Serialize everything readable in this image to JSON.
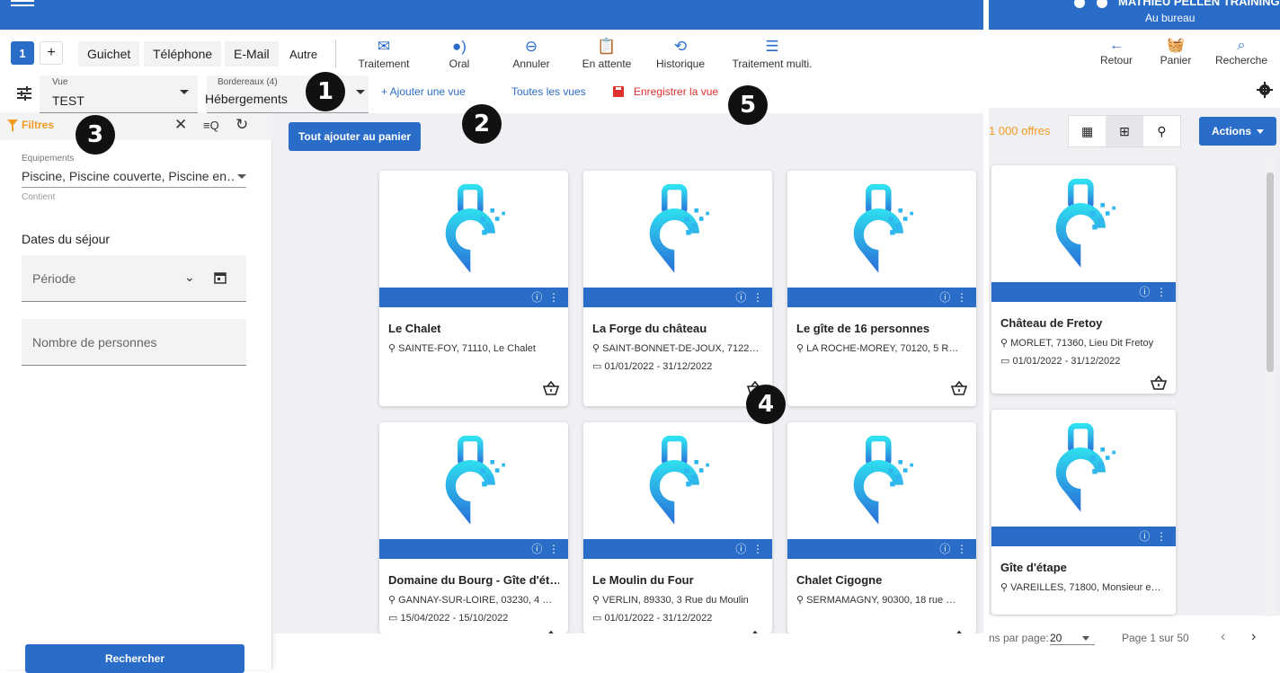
{
  "header": {
    "user_name": "MATHIEU PELLEN TRAINING",
    "user_status": "Au bureau"
  },
  "toolbar": {
    "tab_number": "1",
    "tab_add": "+",
    "channels": [
      "Guichet",
      "Téléphone",
      "E-Mail",
      "Autre"
    ],
    "tools": [
      {
        "label": "Traitement",
        "icon": "mail-icon"
      },
      {
        "label": "Oral",
        "icon": "voice-icon"
      },
      {
        "label": "Annuler",
        "icon": "cancel-icon"
      },
      {
        "label": "En attente",
        "icon": "clipboard-icon"
      },
      {
        "label": "Historique",
        "icon": "history-icon"
      },
      {
        "label": "Traitement multi.",
        "icon": "list-icon"
      }
    ]
  },
  "view_bar": {
    "vue_label": "Vue",
    "vue_value": "TEST",
    "bordereaux_label": "Bordereaux (4)",
    "bordereaux_value": "Hébergements",
    "add_view": "+ Ajouter une vue",
    "all_views": "Toutes les vues",
    "save_view": "Enregistrer la vue"
  },
  "filters": {
    "title": "Filtres",
    "equip_label": "Equipements",
    "equip_value": "Piscine, Piscine couverte, Piscine en…",
    "equip_sub": "Contient",
    "dates_title": "Dates du séjour",
    "period_placeholder": "Période",
    "persons_placeholder": "Nombre de personnes",
    "search_button": "Rechercher"
  },
  "main": {
    "add_all": "Tout ajouter au panier",
    "cards": [
      {
        "title": "Le Chalet",
        "address": "SAINTE-FOY, 71110, Le Chalet",
        "dates": ""
      },
      {
        "title": "La Forge du château",
        "address": "SAINT-BONNET-DE-JOUX, 7122…",
        "dates": "01/01/2022 - 31/12/2022"
      },
      {
        "title": "Le gîte de 16 personnes",
        "address": "LA ROCHE-MOREY, 70120, 5 R…",
        "dates": ""
      },
      {
        "title": "Domaine du Bourg - Gîte d'ét…",
        "address": "GANNAY-SUR-LOIRE, 03230, 4 …",
        "dates": "15/04/2022 - 15/10/2022"
      },
      {
        "title": "Le Moulin du Four",
        "address": "VERLIN, 89330, 3 Rue du Moulin",
        "dates": "01/01/2022 - 31/12/2022"
      },
      {
        "title": "Chalet Cigogne",
        "address": "SERMAMAGNY, 90300, 18 rue …",
        "dates": ""
      }
    ]
  },
  "right": {
    "tools": [
      {
        "label": "Retour",
        "icon": "arrow-left-icon"
      },
      {
        "label": "Panier",
        "icon": "basket-icon"
      },
      {
        "label": "Recherche",
        "icon": "search-icon"
      }
    ],
    "offers": "1 000 offres",
    "actions": "Actions",
    "cards": [
      {
        "title": "Château de Fretoy",
        "address": "MORLET, 71360, Lieu Dit Fretoy",
        "dates": "01/01/2022 - 31/12/2022"
      },
      {
        "title": "Gîte d'étape",
        "address": "VAREILLES, 71800, Monsieur e…",
        "dates": ""
      }
    ],
    "per_page_label": "ns par page:",
    "per_page_value": "20",
    "page_info": "Page 1 sur 50"
  },
  "badges": [
    "1",
    "2",
    "3",
    "4",
    "5"
  ],
  "colors": {
    "primary": "#2a6dc8",
    "accent": "#f59a23",
    "danger": "#e0302f"
  }
}
